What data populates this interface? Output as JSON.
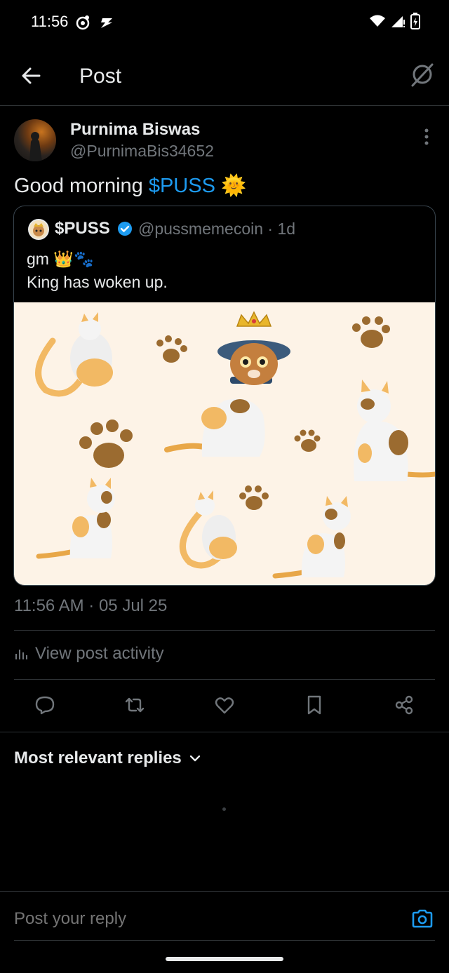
{
  "status_bar": {
    "time": "11:56"
  },
  "header": {
    "title": "Post"
  },
  "post": {
    "author_name": "Purnima Biswas",
    "author_handle": "@PurnimaBis34652",
    "text_prefix": "Good morning ",
    "cashtag": "$PUSS",
    "text_emoji": "🌞",
    "timestamp": "11:56 AM · 05 Jul 25"
  },
  "quote": {
    "name": "$PUSS",
    "handle_time": "@pussmemecoin · 1d",
    "line1": "gm 👑🐾",
    "line2": "King has woken up."
  },
  "activity": {
    "label": "View post activity"
  },
  "replies": {
    "sort_label": "Most relevant replies"
  },
  "reply_box": {
    "placeholder": "Post your reply"
  },
  "colors": {
    "accent": "#1d9bf0",
    "background": "#000000",
    "muted": "#71767b"
  }
}
